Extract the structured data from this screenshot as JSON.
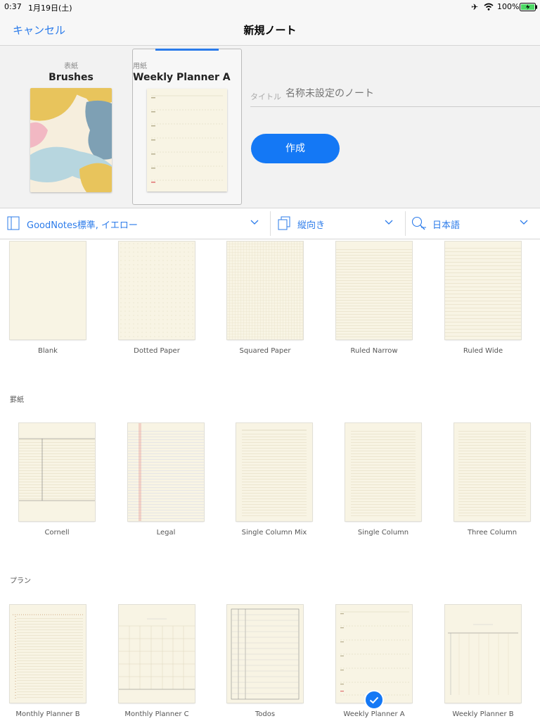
{
  "status": {
    "time": "0:37",
    "date": "1月19日(土)",
    "battery": "100%"
  },
  "nav": {
    "cancel": "キャンセル",
    "title": "新規ノート"
  },
  "cover": {
    "small_label": "表紙",
    "name": "Brushes"
  },
  "paper": {
    "small_label": "用紙",
    "name": "Weekly Planner A"
  },
  "title_field": {
    "label": "タイトル",
    "placeholder": "名称未設定のノート"
  },
  "create_button": "作成",
  "filters": {
    "template_set": "GoodNotes標準, イエロー",
    "orientation": "縦向き",
    "language": "日本語"
  },
  "basic_templates": [
    "Blank",
    "Dotted Paper",
    "Squared Paper",
    "Ruled Narrow",
    "Ruled Wide"
  ],
  "ruled_section": {
    "title": "罫紙",
    "items": [
      "Cornell",
      "Legal",
      "Single Column Mix",
      "Single Column",
      "Three Column"
    ]
  },
  "plan_section": {
    "title": "プラン",
    "items": [
      "Monthly Planner B",
      "Monthly Planner C",
      "Todos",
      "Weekly Planner A",
      "Weekly Planner B"
    ]
  },
  "selected_template": "Weekly Planner A",
  "colors": {
    "accent": "#1478f5",
    "paper": "#f8f4e4"
  }
}
